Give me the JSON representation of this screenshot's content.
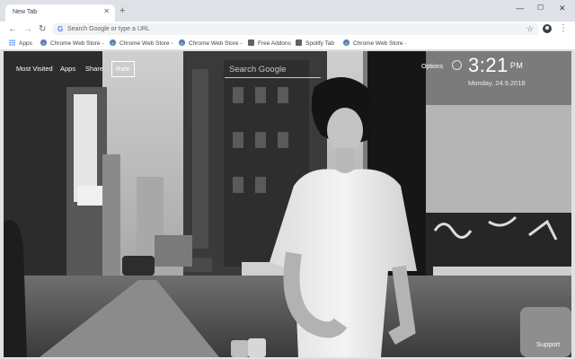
{
  "browser": {
    "tab_title": "New Tab",
    "omnibox_placeholder": "Search Google or type a URL",
    "bookmarks": [
      {
        "label": "Apps",
        "icon": "apps-icon"
      },
      {
        "label": "Chrome Web Store -",
        "icon": "chrome-web-store-icon"
      },
      {
        "label": "Chrome Web Store -",
        "icon": "chrome-web-store-icon"
      },
      {
        "label": "Chrome Web Store -",
        "icon": "chrome-web-store-icon"
      },
      {
        "label": "Free Addons",
        "icon": "page-icon"
      },
      {
        "label": "Spotify Tab",
        "icon": "page-icon"
      },
      {
        "label": "Chrome Web Store -",
        "icon": "chrome-web-store-icon"
      }
    ]
  },
  "newtab": {
    "nav": {
      "most_visited": "Most Visited",
      "apps": "Apps",
      "share": "Share",
      "rate": "Rate"
    },
    "search_placeholder": "Search Google",
    "options": "Options",
    "time": "3:21",
    "ampm": "PM",
    "date": "Monday, 24.9.2018",
    "support": "Support"
  },
  "colors": {
    "tabstrip": "#dee1e6",
    "accent": "#4285f4",
    "overlay_text": "#ffffff"
  }
}
